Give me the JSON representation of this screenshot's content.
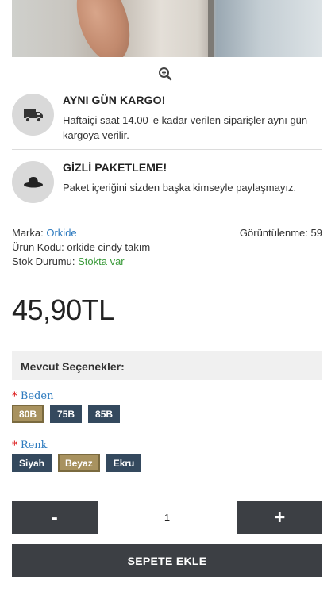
{
  "product_image": {
    "alt": ""
  },
  "shipping": {
    "title": "AYNI GÜN KARGO!",
    "desc": "Haftaiçi saat 14.00 'e kadar verilen siparişler aynı gün kargoya verilir.",
    "icon": "truck-icon"
  },
  "packaging": {
    "title": "GİZLİ PAKETLEME!",
    "desc": "Paket içeriğini sizden başka kimseyle paylaşmayız.",
    "icon": "hat-icon"
  },
  "meta": {
    "brand_label": "Marka:",
    "brand_value": "Orkide",
    "views_label": "Görüntülenme:",
    "views_value": "59",
    "code_label": "Ürün Kodu:",
    "code_value": "orkide cindy takım",
    "stock_label": "Stok Durumu:",
    "stock_value": "Stokta var"
  },
  "price": "45,90TL",
  "options": {
    "title": "Mevcut Seçenekler:",
    "size": {
      "required": "*",
      "label": "Beden",
      "values": [
        "80B",
        "75B",
        "85B"
      ],
      "selected": "80B"
    },
    "color": {
      "required": "*",
      "label": "Renk",
      "values": [
        "Siyah",
        "Beyaz",
        "Ekru"
      ],
      "selected": "Beyaz"
    }
  },
  "quantity": {
    "minus": "-",
    "plus": "+",
    "value": "1"
  },
  "add_to_cart": "SEPETE EKLE",
  "colors": {
    "dark_button": "#3c3f44",
    "chip": "#34495e",
    "chip_selected": "#a8925f",
    "link": "#2e7bbf",
    "stock": "#3a9a3a"
  }
}
